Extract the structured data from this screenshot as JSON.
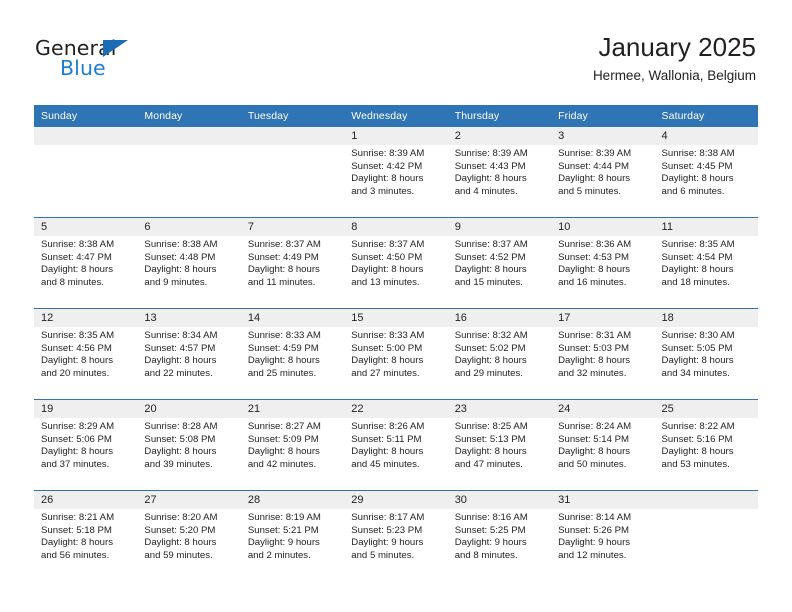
{
  "logo": {
    "word_one": "General",
    "word_two": "Blue",
    "triangle_color": "#1c6cb5",
    "blue_color": "#1c7fd4"
  },
  "header": {
    "title": "January 2025",
    "location": "Hermee, Wallonia, Belgium"
  },
  "theme": {
    "header_bg": "#2f74b5",
    "daynum_bg": "#efefef",
    "text": "#231f20",
    "row_divider": "#2f74b5"
  },
  "weekday_headers": [
    "Sunday",
    "Monday",
    "Tuesday",
    "Wednesday",
    "Thursday",
    "Friday",
    "Saturday"
  ],
  "labels": {
    "sunrise": "Sunrise:",
    "sunset": "Sunset:",
    "daylight": "Daylight:"
  },
  "weeks": [
    [
      {
        "day": "",
        "sunrise": "",
        "sunset": "",
        "daylight_a": "",
        "daylight_b": ""
      },
      {
        "day": "",
        "sunrise": "",
        "sunset": "",
        "daylight_a": "",
        "daylight_b": ""
      },
      {
        "day": "",
        "sunrise": "",
        "sunset": "",
        "daylight_a": "",
        "daylight_b": ""
      },
      {
        "day": "1",
        "sunrise": "Sunrise: 8:39 AM",
        "sunset": "Sunset: 4:42 PM",
        "daylight_a": "Daylight: 8 hours",
        "daylight_b": "and 3 minutes."
      },
      {
        "day": "2",
        "sunrise": "Sunrise: 8:39 AM",
        "sunset": "Sunset: 4:43 PM",
        "daylight_a": "Daylight: 8 hours",
        "daylight_b": "and 4 minutes."
      },
      {
        "day": "3",
        "sunrise": "Sunrise: 8:39 AM",
        "sunset": "Sunset: 4:44 PM",
        "daylight_a": "Daylight: 8 hours",
        "daylight_b": "and 5 minutes."
      },
      {
        "day": "4",
        "sunrise": "Sunrise: 8:38 AM",
        "sunset": "Sunset: 4:45 PM",
        "daylight_a": "Daylight: 8 hours",
        "daylight_b": "and 6 minutes."
      }
    ],
    [
      {
        "day": "5",
        "sunrise": "Sunrise: 8:38 AM",
        "sunset": "Sunset: 4:47 PM",
        "daylight_a": "Daylight: 8 hours",
        "daylight_b": "and 8 minutes."
      },
      {
        "day": "6",
        "sunrise": "Sunrise: 8:38 AM",
        "sunset": "Sunset: 4:48 PM",
        "daylight_a": "Daylight: 8 hours",
        "daylight_b": "and 9 minutes."
      },
      {
        "day": "7",
        "sunrise": "Sunrise: 8:37 AM",
        "sunset": "Sunset: 4:49 PM",
        "daylight_a": "Daylight: 8 hours",
        "daylight_b": "and 11 minutes."
      },
      {
        "day": "8",
        "sunrise": "Sunrise: 8:37 AM",
        "sunset": "Sunset: 4:50 PM",
        "daylight_a": "Daylight: 8 hours",
        "daylight_b": "and 13 minutes."
      },
      {
        "day": "9",
        "sunrise": "Sunrise: 8:37 AM",
        "sunset": "Sunset: 4:52 PM",
        "daylight_a": "Daylight: 8 hours",
        "daylight_b": "and 15 minutes."
      },
      {
        "day": "10",
        "sunrise": "Sunrise: 8:36 AM",
        "sunset": "Sunset: 4:53 PM",
        "daylight_a": "Daylight: 8 hours",
        "daylight_b": "and 16 minutes."
      },
      {
        "day": "11",
        "sunrise": "Sunrise: 8:35 AM",
        "sunset": "Sunset: 4:54 PM",
        "daylight_a": "Daylight: 8 hours",
        "daylight_b": "and 18 minutes."
      }
    ],
    [
      {
        "day": "12",
        "sunrise": "Sunrise: 8:35 AM",
        "sunset": "Sunset: 4:56 PM",
        "daylight_a": "Daylight: 8 hours",
        "daylight_b": "and 20 minutes."
      },
      {
        "day": "13",
        "sunrise": "Sunrise: 8:34 AM",
        "sunset": "Sunset: 4:57 PM",
        "daylight_a": "Daylight: 8 hours",
        "daylight_b": "and 22 minutes."
      },
      {
        "day": "14",
        "sunrise": "Sunrise: 8:33 AM",
        "sunset": "Sunset: 4:59 PM",
        "daylight_a": "Daylight: 8 hours",
        "daylight_b": "and 25 minutes."
      },
      {
        "day": "15",
        "sunrise": "Sunrise: 8:33 AM",
        "sunset": "Sunset: 5:00 PM",
        "daylight_a": "Daylight: 8 hours",
        "daylight_b": "and 27 minutes."
      },
      {
        "day": "16",
        "sunrise": "Sunrise: 8:32 AM",
        "sunset": "Sunset: 5:02 PM",
        "daylight_a": "Daylight: 8 hours",
        "daylight_b": "and 29 minutes."
      },
      {
        "day": "17",
        "sunrise": "Sunrise: 8:31 AM",
        "sunset": "Sunset: 5:03 PM",
        "daylight_a": "Daylight: 8 hours",
        "daylight_b": "and 32 minutes."
      },
      {
        "day": "18",
        "sunrise": "Sunrise: 8:30 AM",
        "sunset": "Sunset: 5:05 PM",
        "daylight_a": "Daylight: 8 hours",
        "daylight_b": "and 34 minutes."
      }
    ],
    [
      {
        "day": "19",
        "sunrise": "Sunrise: 8:29 AM",
        "sunset": "Sunset: 5:06 PM",
        "daylight_a": "Daylight: 8 hours",
        "daylight_b": "and 37 minutes."
      },
      {
        "day": "20",
        "sunrise": "Sunrise: 8:28 AM",
        "sunset": "Sunset: 5:08 PM",
        "daylight_a": "Daylight: 8 hours",
        "daylight_b": "and 39 minutes."
      },
      {
        "day": "21",
        "sunrise": "Sunrise: 8:27 AM",
        "sunset": "Sunset: 5:09 PM",
        "daylight_a": "Daylight: 8 hours",
        "daylight_b": "and 42 minutes."
      },
      {
        "day": "22",
        "sunrise": "Sunrise: 8:26 AM",
        "sunset": "Sunset: 5:11 PM",
        "daylight_a": "Daylight: 8 hours",
        "daylight_b": "and 45 minutes."
      },
      {
        "day": "23",
        "sunrise": "Sunrise: 8:25 AM",
        "sunset": "Sunset: 5:13 PM",
        "daylight_a": "Daylight: 8 hours",
        "daylight_b": "and 47 minutes."
      },
      {
        "day": "24",
        "sunrise": "Sunrise: 8:24 AM",
        "sunset": "Sunset: 5:14 PM",
        "daylight_a": "Daylight: 8 hours",
        "daylight_b": "and 50 minutes."
      },
      {
        "day": "25",
        "sunrise": "Sunrise: 8:22 AM",
        "sunset": "Sunset: 5:16 PM",
        "daylight_a": "Daylight: 8 hours",
        "daylight_b": "and 53 minutes."
      }
    ],
    [
      {
        "day": "26",
        "sunrise": "Sunrise: 8:21 AM",
        "sunset": "Sunset: 5:18 PM",
        "daylight_a": "Daylight: 8 hours",
        "daylight_b": "and 56 minutes."
      },
      {
        "day": "27",
        "sunrise": "Sunrise: 8:20 AM",
        "sunset": "Sunset: 5:20 PM",
        "daylight_a": "Daylight: 8 hours",
        "daylight_b": "and 59 minutes."
      },
      {
        "day": "28",
        "sunrise": "Sunrise: 8:19 AM",
        "sunset": "Sunset: 5:21 PM",
        "daylight_a": "Daylight: 9 hours",
        "daylight_b": "and 2 minutes."
      },
      {
        "day": "29",
        "sunrise": "Sunrise: 8:17 AM",
        "sunset": "Sunset: 5:23 PM",
        "daylight_a": "Daylight: 9 hours",
        "daylight_b": "and 5 minutes."
      },
      {
        "day": "30",
        "sunrise": "Sunrise: 8:16 AM",
        "sunset": "Sunset: 5:25 PM",
        "daylight_a": "Daylight: 9 hours",
        "daylight_b": "and 8 minutes."
      },
      {
        "day": "31",
        "sunrise": "Sunrise: 8:14 AM",
        "sunset": "Sunset: 5:26 PM",
        "daylight_a": "Daylight: 9 hours",
        "daylight_b": "and 12 minutes."
      },
      {
        "day": "",
        "sunrise": "",
        "sunset": "",
        "daylight_a": "",
        "daylight_b": ""
      }
    ]
  ]
}
